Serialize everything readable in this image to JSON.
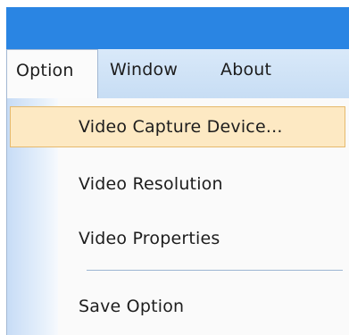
{
  "menubar": {
    "items": [
      {
        "label": "Option"
      },
      {
        "label": "Window"
      },
      {
        "label": "About"
      }
    ]
  },
  "dropdown": {
    "items": [
      {
        "label": "Video Capture Device..."
      },
      {
        "label": "Video Resolution"
      },
      {
        "label": "Video Properties"
      },
      {
        "label": "Save Option"
      }
    ]
  }
}
